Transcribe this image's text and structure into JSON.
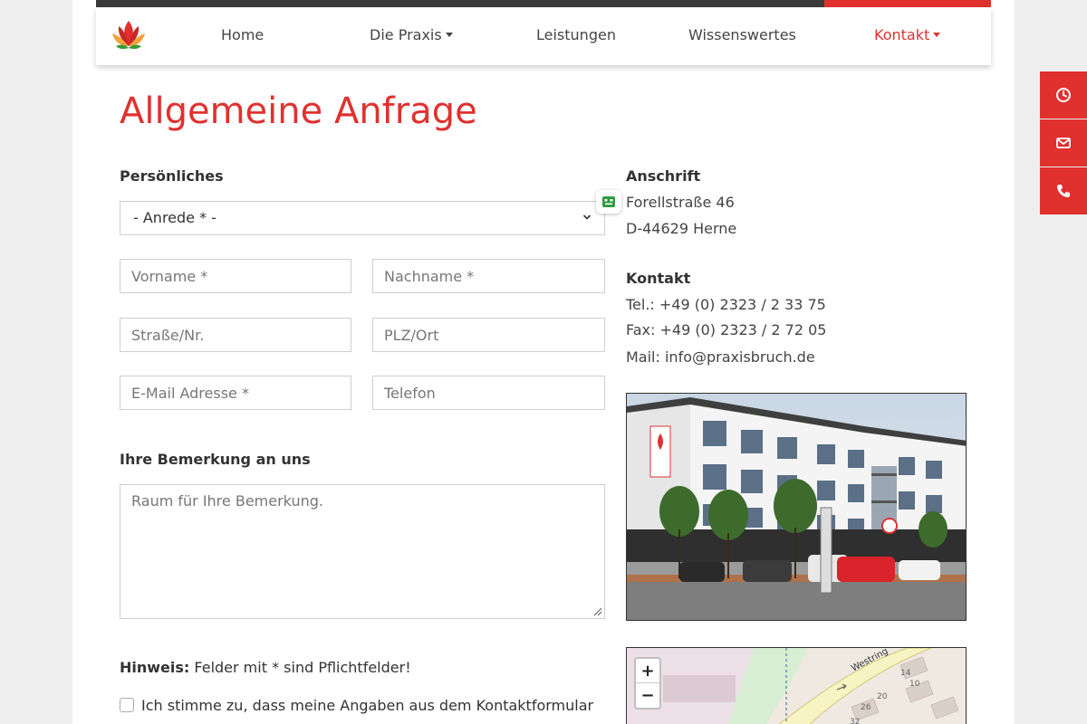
{
  "nav": {
    "items": [
      {
        "label": "Home",
        "has_dropdown": false,
        "active": false
      },
      {
        "label": "Die Praxis",
        "has_dropdown": true,
        "active": false
      },
      {
        "label": "Leistungen",
        "has_dropdown": false,
        "active": false
      },
      {
        "label": "Wissenswertes",
        "has_dropdown": false,
        "active": false
      },
      {
        "label": "Kontakt",
        "has_dropdown": true,
        "active": true
      }
    ]
  },
  "side_tabs": [
    "clock-icon",
    "mail-icon",
    "phone-icon"
  ],
  "page_title": "Allgemeine Anfrage",
  "form": {
    "section_personal": "Persönliches",
    "salutation_selected": "- Anrede * -",
    "first_name_placeholder": "Vorname *",
    "last_name_placeholder": "Nachname *",
    "street_placeholder": "Straße/Nr.",
    "zip_city_placeholder": "PLZ/Ort",
    "email_placeholder": "E-Mail Adresse *",
    "phone_placeholder": "Telefon",
    "section_remark": "Ihre Bemerkung an uns",
    "remark_placeholder": "Raum für Ihre Bemerkung.",
    "hint_bold": "Hinweis:",
    "hint_text": " Felder mit * sind Pflichtfelder!",
    "consent_text": "Ich stimme zu, dass meine Angaben aus dem Kontaktformular"
  },
  "address": {
    "heading": "Anschrift",
    "street": "Forellstraße 46",
    "city": "D-44629 Herne"
  },
  "contact": {
    "heading": "Kontakt",
    "tel": "Tel.: +49 (0) 2323 / 2 33 75",
    "fax": "Fax: +49 (0) 2323 / 2 72 05",
    "mail": "Mail: info@praxisbruch.de"
  },
  "map": {
    "zoom_in": "+",
    "zoom_out": "−",
    "street_label": "Westring",
    "house_numbers": [
      "14",
      "10",
      "26",
      "20",
      "32"
    ]
  },
  "colors": {
    "accent": "#e0312f",
    "dark_bar": "#3a3a3a"
  }
}
